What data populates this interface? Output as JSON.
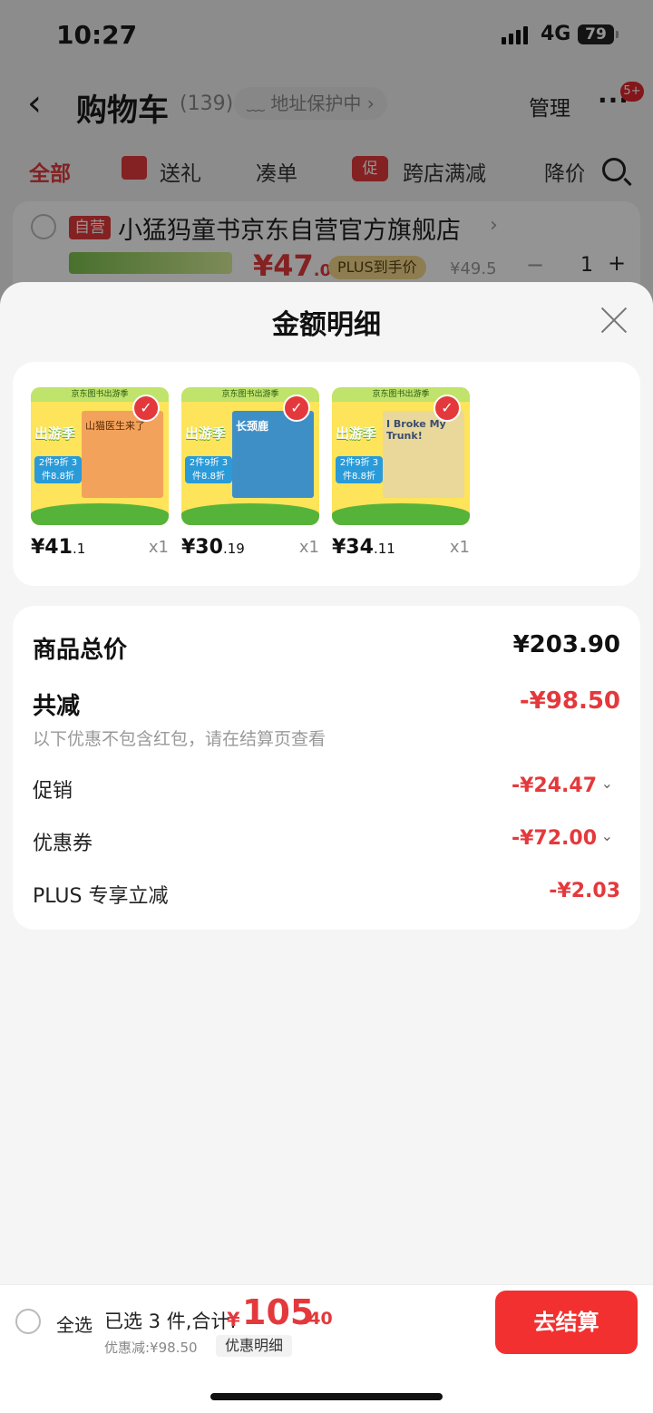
{
  "status_bar": {
    "time": "10:27",
    "network": "4G",
    "battery": "79"
  },
  "nav": {
    "back": "‹",
    "title": "购物车",
    "count": "(139)",
    "address_protect": "﹏ 地址保护中 ›",
    "manage": "管理",
    "more": "···",
    "message_badge": "5+"
  },
  "tabs": [
    {
      "label": "全部"
    },
    {
      "label": "送礼"
    },
    {
      "label": "凑单"
    },
    {
      "label": "跨店满减"
    },
    {
      "label": "降价"
    }
  ],
  "promo_icon": "促",
  "store": {
    "self_tag": "自营",
    "name": "小猛犸童书京东自营官方旗舰店",
    "arrow": "›",
    "price_int": "¥47",
    "price_dec": ".01",
    "plus_label": "PLUS到手价",
    "orig_price": "¥49.5",
    "minus": "−",
    "qty": "1",
    "plus": "+"
  },
  "sheet": {
    "title": "金额明细",
    "goods": [
      {
        "price_int": "¥41",
        "price_dec": ".1",
        "qty": "x1",
        "cover_color": "#f3a25c",
        "cover_text": "山猫医生来了",
        "band": "京东图书出游季",
        "logo": "出游季",
        "promo": "2件9折 3件8.8折"
      },
      {
        "price_int": "¥30",
        "price_dec": ".19",
        "qty": "x1",
        "cover_color": "#3f8fc7",
        "cover_text": "长颈鹿",
        "band": "京东图书出游季",
        "logo": "出游季",
        "promo": "2件9折 3件8.8折"
      },
      {
        "price_int": "¥34",
        "price_dec": ".11",
        "qty": "x1",
        "cover_color": "#e9d89a",
        "cover_text": "I Broke My Trunk!",
        "band": "京东图书出游季",
        "logo": "出游季",
        "promo": "2件9折 3件8.8折"
      }
    ],
    "check_mark": "✓",
    "total_label": "商品总价",
    "total_value": "¥203.90",
    "discount_label": "共减",
    "discount_value": "-¥98.50",
    "discount_note": "以下优惠不包含红包，请在结算页查看",
    "promo_label": "促销",
    "promo_value": "-¥24.47",
    "coupon_label": "优惠券",
    "coupon_value": "-¥72.00",
    "plus_label": "PLUS 专享立减",
    "plus_value": "-¥2.03",
    "chevron": "⌄"
  },
  "bottom": {
    "select_all": "全选",
    "selected": "已选 3 件,合计:",
    "currency": "¥",
    "total_int": "105",
    "total_dec": ".40",
    "saved": "优惠减:¥98.50",
    "detail": "优惠明细",
    "checkout": "去结算"
  },
  "colors": {
    "accent": "#e4393c",
    "checkout": "#f23030",
    "sheet_bg": "#f5f5f5"
  }
}
